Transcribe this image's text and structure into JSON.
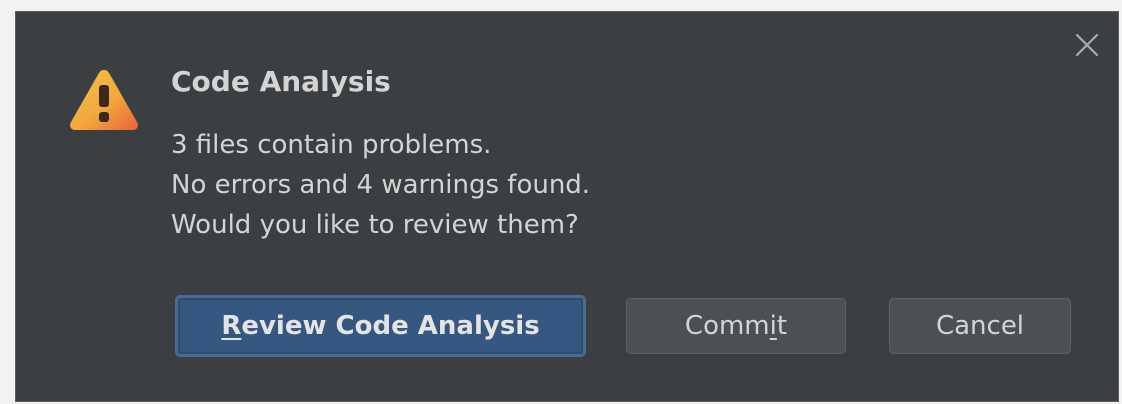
{
  "dialog": {
    "title": "Code Analysis",
    "message_lines": [
      "3 files contain problems.",
      "No errors and 4 warnings found.",
      "Would you like to review them?"
    ],
    "icons": {
      "warning": "warning-triangle-icon",
      "close": "close-icon"
    }
  },
  "buttons": {
    "review": {
      "mnemonic": "R",
      "rest": "eview Code Analysis"
    },
    "commit": {
      "before": "Comm",
      "mnemonic": "i",
      "after": "t"
    },
    "cancel": {
      "label": "Cancel"
    }
  },
  "colors": {
    "background": "#3c3f41",
    "text": "#d4d4d4",
    "primary_button": "#365880",
    "secondary_button": "#4c5052",
    "warning_gradient_start": "#f7c443",
    "warning_gradient_end": "#e8643c"
  }
}
